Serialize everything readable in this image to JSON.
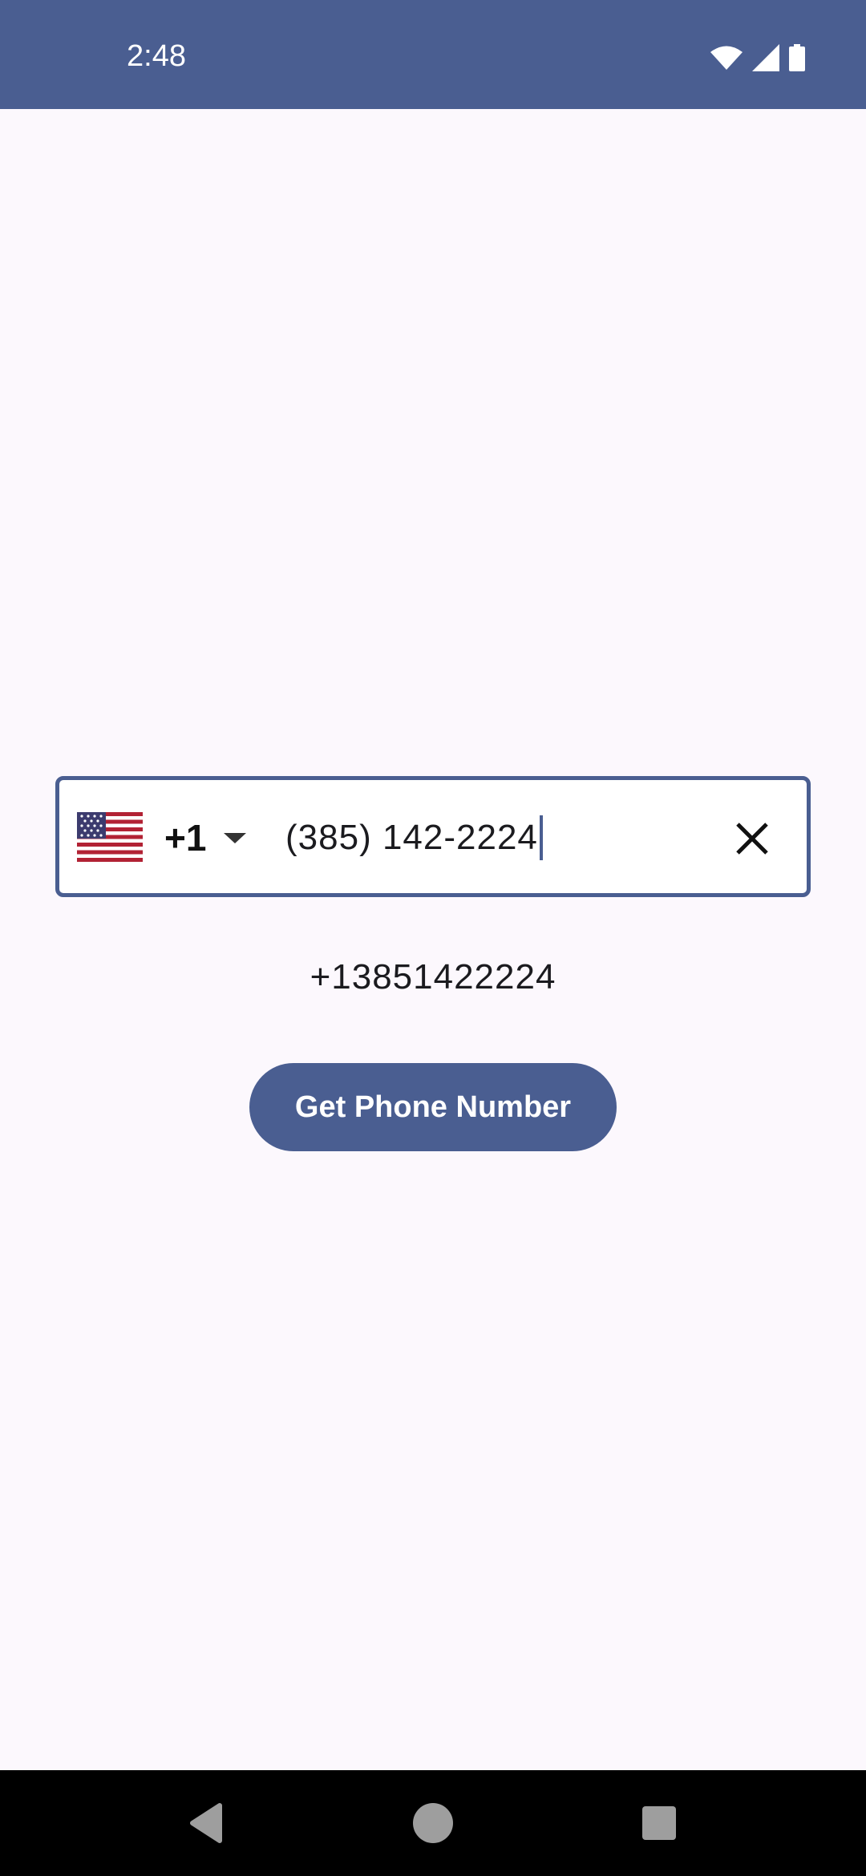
{
  "status_bar": {
    "time": "2:48",
    "icons": [
      "wifi-icon",
      "cell-signal-icon",
      "battery-icon"
    ],
    "color": "#4a5e91"
  },
  "phone_field": {
    "country_flag": "us-flag-icon",
    "dial_code": "+1",
    "value": "(385) 142-2224"
  },
  "result": {
    "formatted_number": "+13851422224"
  },
  "actions": {
    "get_phone_number_label": "Get Phone Number"
  },
  "nav_bar": {
    "items": [
      "back-icon",
      "home-icon",
      "recents-icon"
    ]
  },
  "colors": {
    "primary": "#4a5e91",
    "background": "#fcf8fd"
  }
}
